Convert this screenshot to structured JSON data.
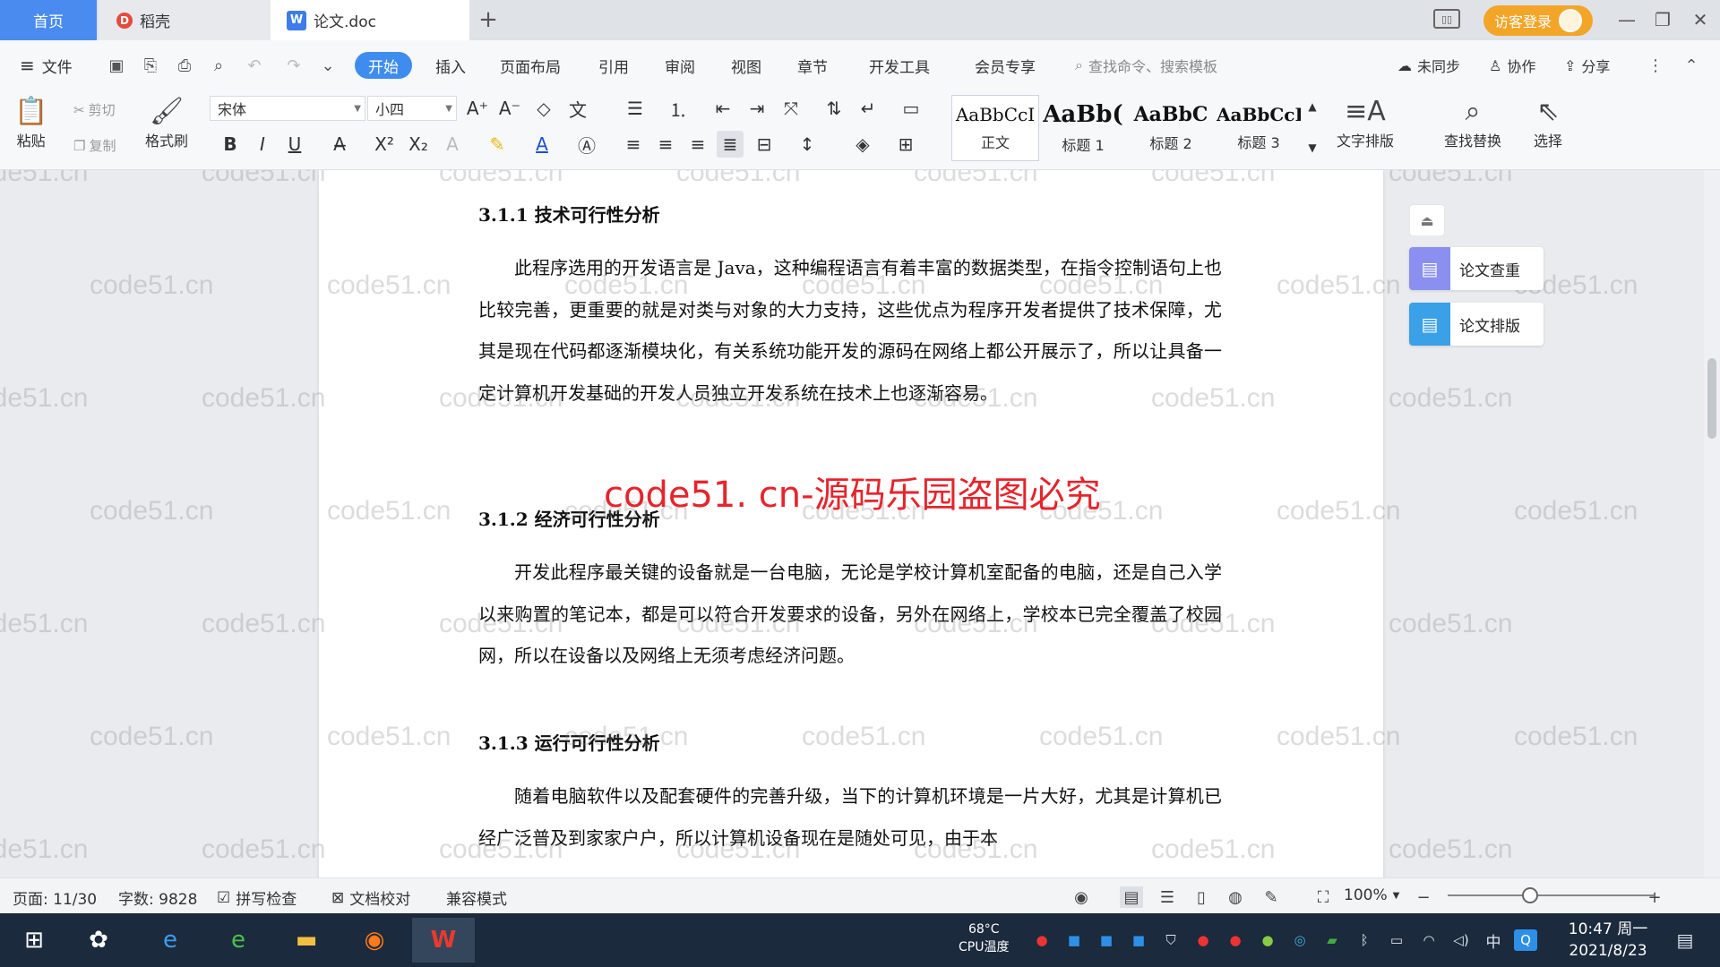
{
  "tabs": {
    "home": "首页",
    "docer": "稻壳",
    "document": "论文.doc",
    "add": "+"
  },
  "titlebar": {
    "login": "访客登录"
  },
  "menu": {
    "file": "文件",
    "items": [
      "开始",
      "插入",
      "页面布局",
      "引用",
      "审阅",
      "视图",
      "章节",
      "开发工具",
      "会员专享"
    ],
    "search_placeholder": "查找命令、搜索模板",
    "sync": "未同步",
    "collaborate": "协作",
    "share": "分享"
  },
  "ribbon": {
    "paste": "粘贴",
    "cut": "剪切",
    "copy": "复制",
    "format_painter": "格式刷",
    "font_name": "宋体",
    "font_size": "小四",
    "styles": [
      {
        "preview": "AaBbCcI",
        "name": "正文"
      },
      {
        "preview": "AaBb(",
        "name": "标题 1"
      },
      {
        "preview": "AaBbC",
        "name": "标题 2"
      },
      {
        "preview": "AaBbCcI",
        "name": "标题 3"
      }
    ],
    "text_layout": "文字排版",
    "find_replace": "查找替换",
    "select": "选择"
  },
  "document": {
    "sections": [
      {
        "heading": "3.1.1  技术可行性分析",
        "body": "此程序选用的开发语言是 Java，这种编程语言有着丰富的数据类型，在指令控制语句上也比较完善，更重要的就是对类与对象的大力支持，这些优点为程序开发者提供了技术保障，尤其是现在代码都逐渐模块化，有关系统功能开发的源码在网络上都公开展示了，所以让具备一定计算机开发基础的开发人员独立开发系统在技术上也逐渐容易。"
      },
      {
        "heading": "3.1.2  经济可行性分析",
        "body": "开发此程序最关键的设备就是一台电脑，无论是学校计算机室配备的电脑，还是自己入学以来购置的笔记本，都是可以符合开发要求的设备，另外在网络上，学校本已完全覆盖了校园网，所以在设备以及网络上无须考虑经济问题。"
      },
      {
        "heading": "3.1.3  运行可行性分析",
        "body": "随着电脑软件以及配套硬件的完善升级，当下的计算机环境是一片大好，尤其是计算机已经广泛普及到家家户户，所以计算机设备现在是随处可见，由于本"
      }
    ],
    "banner": "code51. cn-源码乐园盗图必究",
    "watermark": "code51.cn"
  },
  "side_panel": {
    "check": "论文查重",
    "format": "论文排版"
  },
  "status": {
    "page": "页面: 11/30",
    "words": "字数: 9828",
    "spell": "拼写检查",
    "proof": "文档校对",
    "compat": "兼容模式",
    "zoom": "100%",
    "zoom_level": 0.4
  },
  "taskbar": {
    "cpu_temp": "68°C",
    "cpu_label": "CPU温度",
    "ime": "中",
    "time": "10:47 周一",
    "date": "2021/8/23"
  },
  "colors": {
    "accent": "#3f8cf0",
    "login": "#f3a528",
    "banner": "#e6242c",
    "taskbar": "#1b2a3c"
  }
}
